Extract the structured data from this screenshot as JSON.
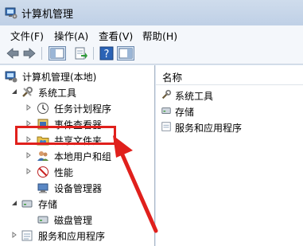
{
  "window": {
    "title": "计算机管理"
  },
  "menu": [
    "文件(F)",
    "操作(A)",
    "查看(V)",
    "帮助(H)"
  ],
  "toolbar": {
    "icons": [
      "back-icon",
      "forward-icon",
      "show-hide-tree-icon",
      "export-list-icon",
      "help-icon",
      "action-pane-icon"
    ]
  },
  "tree": {
    "root": "计算机管理(本地)",
    "system_tools": "系统工具",
    "task_scheduler": "任务计划程序",
    "event_viewer": "事件查看器",
    "shared_folders": "共享文件夹",
    "local_users": "本地用户和组",
    "performance": "性能",
    "device_manager": "设备管理器",
    "storage": "存储",
    "disk_management": "磁盘管理",
    "services_apps": "服务和应用程序"
  },
  "right": {
    "header": "名称",
    "items": [
      "系统工具",
      "存储",
      "服务和应用程序"
    ]
  },
  "colors": {
    "highlight": "#e0201c",
    "arrow": "#e0201c"
  }
}
